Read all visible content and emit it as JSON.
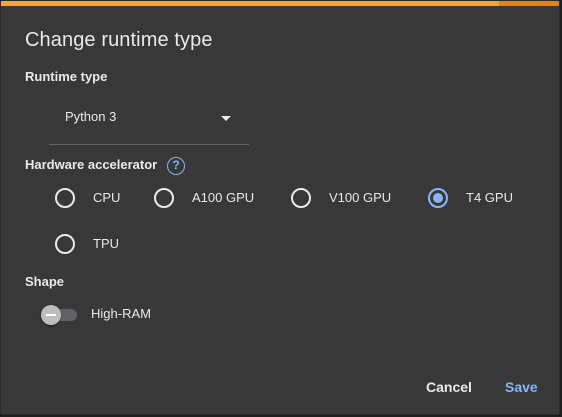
{
  "dialog": {
    "title": "Change runtime type"
  },
  "runtime": {
    "label": "Runtime type",
    "selected": "Python 3"
  },
  "hardware": {
    "label": "Hardware accelerator",
    "help_icon": "help-circle-icon",
    "help_glyph": "?",
    "options": [
      {
        "label": "CPU",
        "checked": false
      },
      {
        "label": "A100 GPU",
        "checked": false
      },
      {
        "label": "V100 GPU",
        "checked": false
      },
      {
        "label": "T4 GPU",
        "checked": true
      },
      {
        "label": "TPU",
        "checked": false
      }
    ]
  },
  "shape": {
    "label": "Shape",
    "toggle_label": "High-RAM",
    "toggle_on": false
  },
  "actions": {
    "cancel": "Cancel",
    "save": "Save"
  },
  "colors": {
    "accent": "#8ab4f8",
    "top_bar": "#f9a825",
    "top_bar_end": "#f57c00",
    "background": "#383838"
  }
}
